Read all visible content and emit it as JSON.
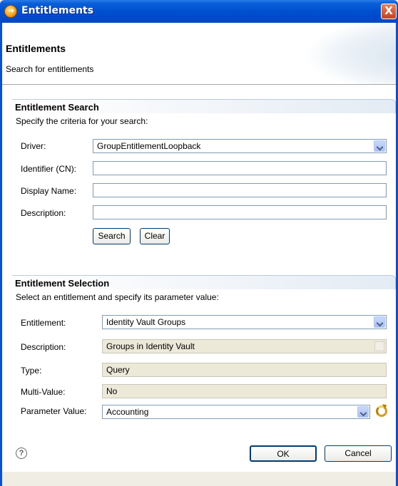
{
  "window": {
    "title": "Entitlements",
    "close_symbol": "X"
  },
  "banner": {
    "title": "Entitlements",
    "description": "Search for entitlements"
  },
  "search": {
    "header": "Entitlement Search",
    "description": "Specify the criteria for your search:",
    "driver_label": "Driver:",
    "driver_value": "GroupEntitlementLoopback",
    "identifier_label": "Identifier (CN):",
    "identifier_value": "",
    "display_name_label": "Display Name:",
    "display_name_value": "",
    "description_label": "Description:",
    "description_value": "",
    "search_button": "Search",
    "clear_button": "Clear"
  },
  "selection": {
    "header": "Entitlement Selection",
    "description": "Select an entitlement and specify its parameter value:",
    "entitlement_label": "Entitlement:",
    "entitlement_value": "Identity Vault Groups",
    "description_label": "Description:",
    "description_value": "Groups in Identity Vault",
    "type_label": "Type:",
    "type_value": "Query",
    "multi_value_label": "Multi-Value:",
    "multi_value_value": "No",
    "parameter_label": "Parameter Value:",
    "parameter_value": "Accounting"
  },
  "footer": {
    "help_symbol": "?",
    "ok_button": "OK",
    "cancel_button": "Cancel"
  },
  "icons": {
    "app": "entitlements-app-icon",
    "close": "close-icon",
    "help": "help-icon",
    "refresh": "refresh-icon",
    "dropdown": "chevron-down-icon"
  },
  "colors": {
    "titlebar": "#0050d0",
    "close_button": "#d0502c",
    "readonly_field": "#ece9d8",
    "field_border": "#7f9db9",
    "button_border": "#003c74"
  }
}
